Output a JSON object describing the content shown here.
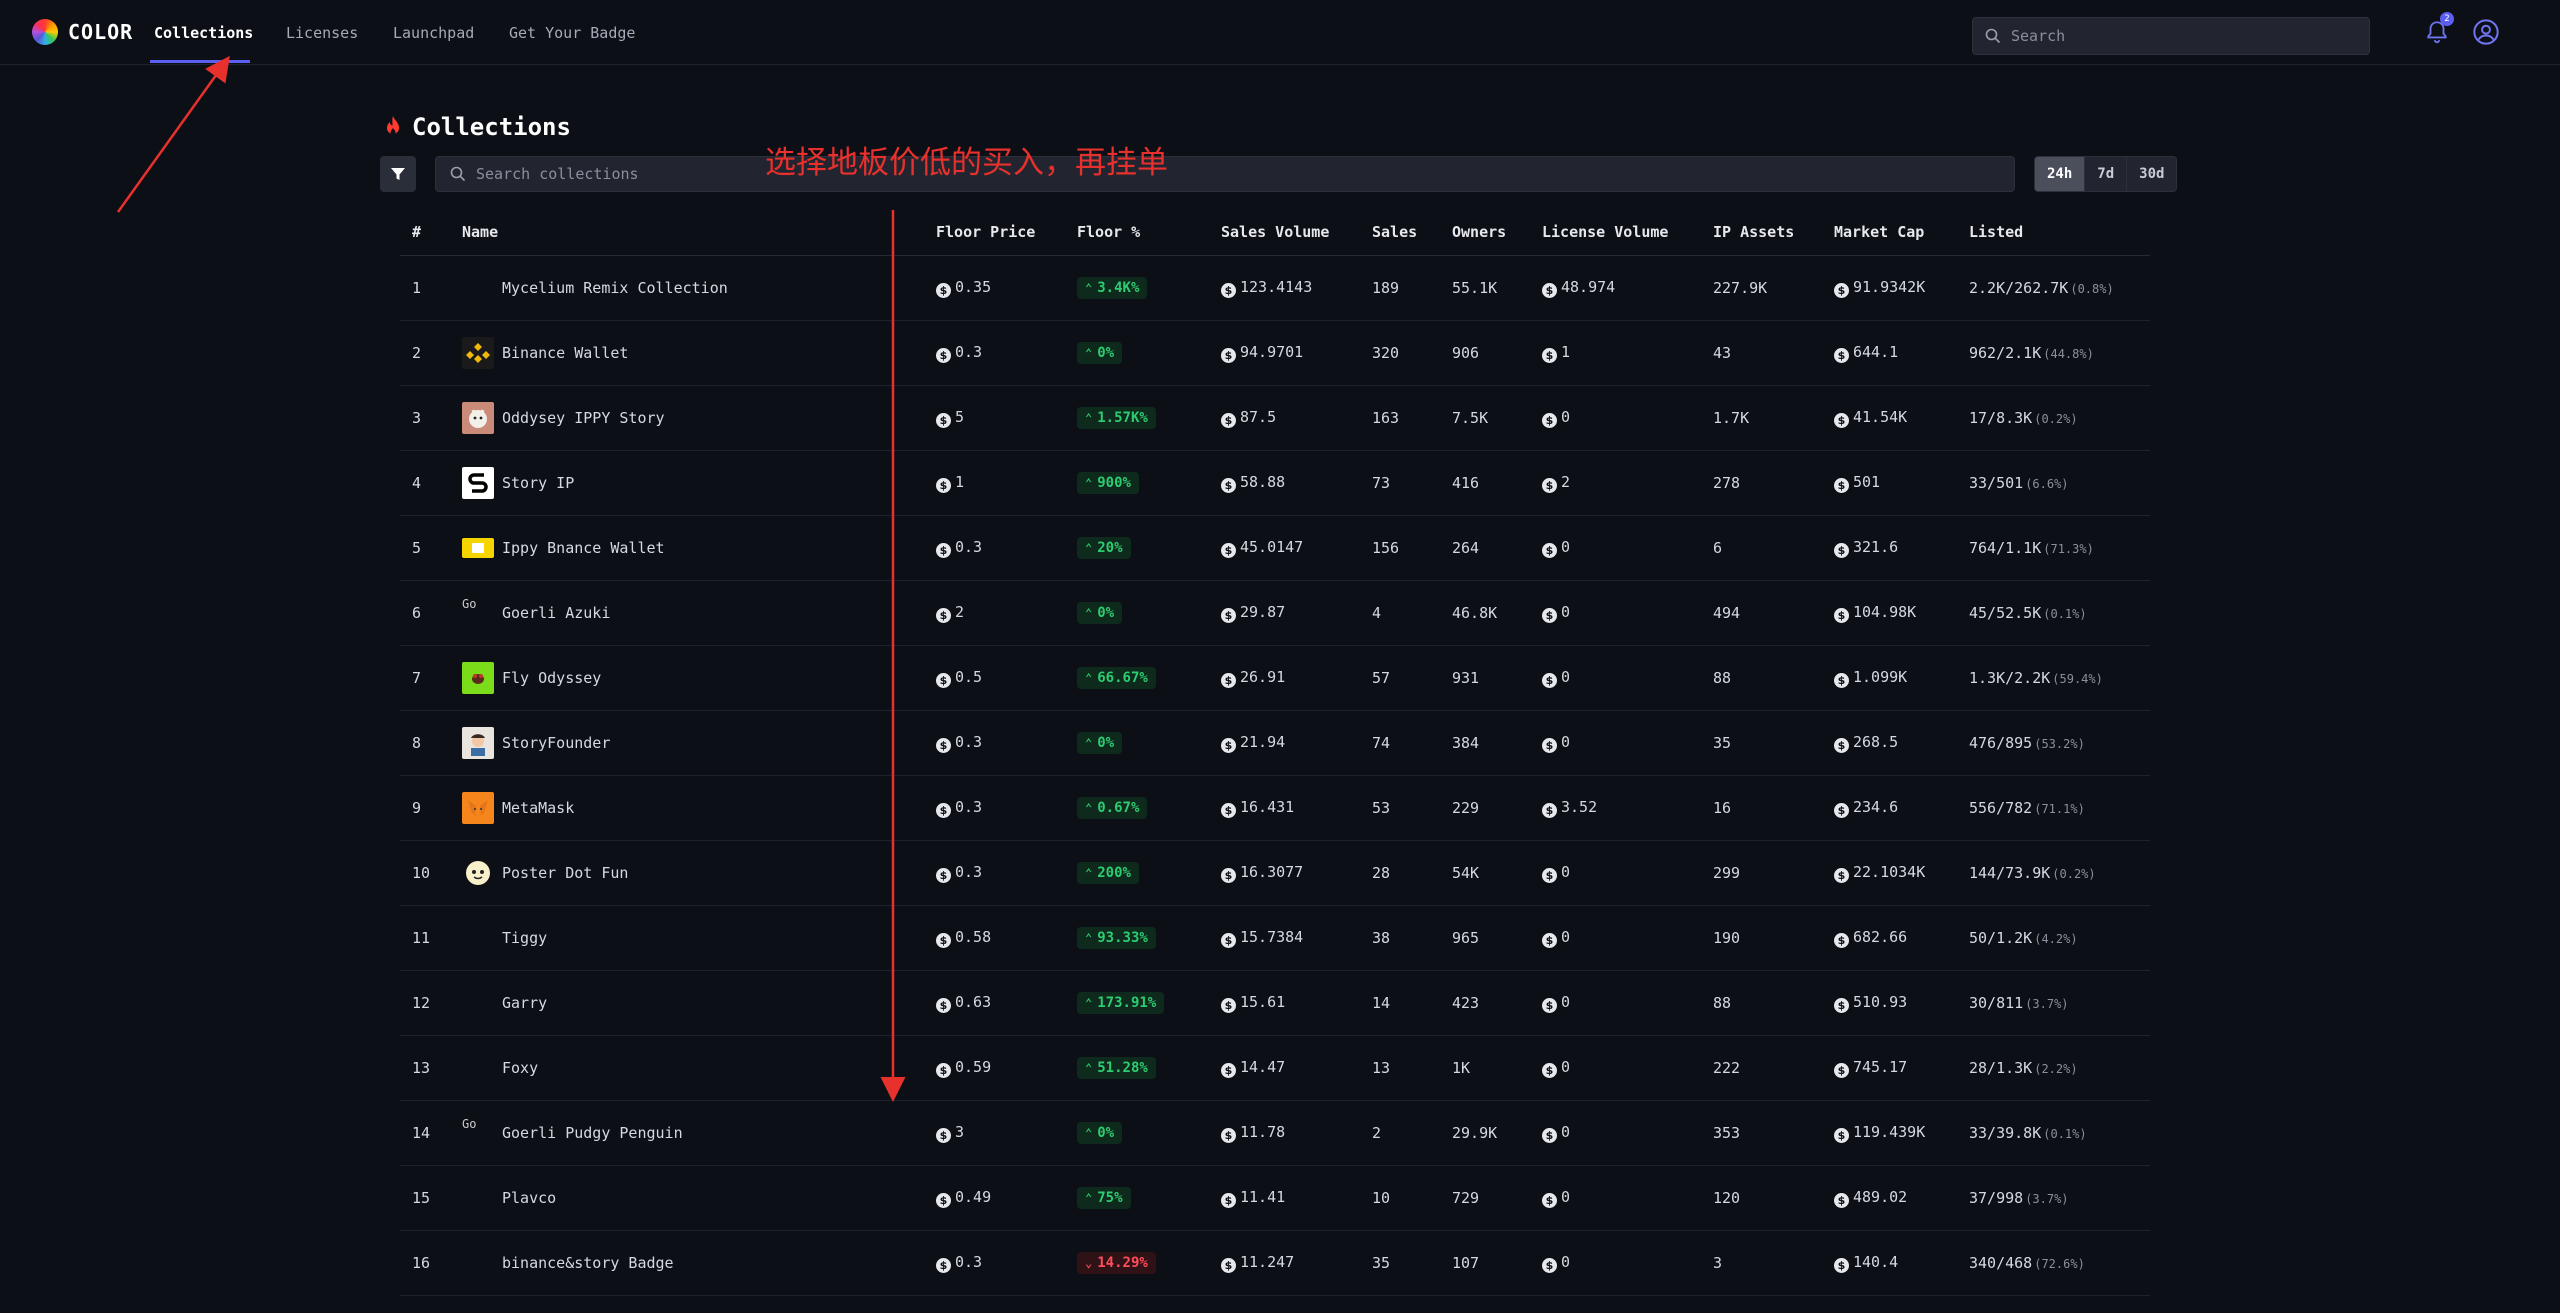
{
  "nav": {
    "logo_text": "COLOR",
    "links": [
      "Collections",
      "Licenses",
      "Launchpad",
      "Get Your Badge"
    ],
    "search_placeholder": "Search",
    "notification_count": "2"
  },
  "page": {
    "title": "Collections",
    "search_placeholder": "Search collections",
    "ranges": [
      "24h",
      "7d",
      "30d"
    ],
    "active_range": "24h"
  },
  "annotation": {
    "text": "选择地板价低的买入，再挂单",
    "color": "#e8302c"
  },
  "colors": {
    "accent": "#5b5ff0",
    "positive": "#2ecc71",
    "negative": "#ff4d5a",
    "background": "#0d0f16"
  },
  "table": {
    "headers": [
      "#",
      "Name",
      "Floor Price",
      "Floor %",
      "Sales Volume",
      "Sales",
      "Owners",
      "License Volume",
      "IP Assets",
      "Market Cap",
      "Listed"
    ],
    "rows": [
      {
        "rank": "1",
        "name": "Mycelium Remix Collection",
        "thumb": "none",
        "floor": "0.35",
        "pct": "3.4K%",
        "dir": "up",
        "volume": "123.4143",
        "sales": "189",
        "owners": "55.1K",
        "license": "48.974",
        "ip": "227.9K",
        "mcap": "91.9342K",
        "listed": "2.2K/262.7K",
        "listed_pct": "(0.8%)"
      },
      {
        "rank": "2",
        "name": "Binance Wallet",
        "thumb": "binance",
        "floor": "0.3",
        "pct": "0%",
        "dir": "up",
        "volume": "94.9701",
        "sales": "320",
        "owners": "906",
        "license": "1",
        "ip": "43",
        "mcap": "644.1",
        "listed": "962/2.1K",
        "listed_pct": "(44.8%)"
      },
      {
        "rank": "3",
        "name": "Oddysey IPPY Story",
        "thumb": "ippy",
        "floor": "5",
        "pct": "1.57K%",
        "dir": "up",
        "volume": "87.5",
        "sales": "163",
        "owners": "7.5K",
        "license": "0",
        "ip": "1.7K",
        "mcap": "41.54K",
        "listed": "17/8.3K",
        "listed_pct": "(0.2%)"
      },
      {
        "rank": "4",
        "name": "Story IP",
        "thumb": "story",
        "floor": "1",
        "pct": "900%",
        "dir": "up",
        "volume": "58.88",
        "sales": "73",
        "owners": "416",
        "license": "2",
        "ip": "278",
        "mcap": "501",
        "listed": "33/501",
        "listed_pct": "(6.6%)"
      },
      {
        "rank": "5",
        "name": "Ippy Bnance Wallet",
        "thumb": "yellow",
        "floor": "0.3",
        "pct": "20%",
        "dir": "up",
        "volume": "45.0147",
        "sales": "156",
        "owners": "264",
        "license": "0",
        "ip": "6",
        "mcap": "321.6",
        "listed": "764/1.1K",
        "listed_pct": "(71.3%)"
      },
      {
        "rank": "6",
        "name": "Goerli Azuki",
        "thumb": "broken",
        "thumb_alt": "Go",
        "floor": "2",
        "pct": "0%",
        "dir": "up",
        "volume": "29.87",
        "sales": "4",
        "owners": "46.8K",
        "license": "0",
        "ip": "494",
        "mcap": "104.98K",
        "listed": "45/52.5K",
        "listed_pct": "(0.1%)"
      },
      {
        "rank": "7",
        "name": "Fly Odyssey",
        "thumb": "fly",
        "floor": "0.5",
        "pct": "66.67%",
        "dir": "up",
        "volume": "26.91",
        "sales": "57",
        "owners": "931",
        "license": "0",
        "ip": "88",
        "mcap": "1.099K",
        "listed": "1.3K/2.2K",
        "listed_pct": "(59.4%)"
      },
      {
        "rank": "8",
        "name": "StoryFounder",
        "thumb": "founder",
        "floor": "0.3",
        "pct": "0%",
        "dir": "up",
        "volume": "21.94",
        "sales": "74",
        "owners": "384",
        "license": "0",
        "ip": "35",
        "mcap": "268.5",
        "listed": "476/895",
        "listed_pct": "(53.2%)"
      },
      {
        "rank": "9",
        "name": "MetaMask",
        "thumb": "metamask",
        "floor": "0.3",
        "pct": "0.67%",
        "dir": "up",
        "volume": "16.431",
        "sales": "53",
        "owners": "229",
        "license": "3.52",
        "ip": "16",
        "mcap": "234.6",
        "listed": "556/782",
        "listed_pct": "(71.1%)"
      },
      {
        "rank": "10",
        "name": "Poster Dot Fun",
        "thumb": "poster",
        "floor": "0.3",
        "pct": "200%",
        "dir": "up",
        "volume": "16.3077",
        "sales": "28",
        "owners": "54K",
        "license": "0",
        "ip": "299",
        "mcap": "22.1034K",
        "listed": "144/73.9K",
        "listed_pct": "(0.2%)"
      },
      {
        "rank": "11",
        "name": "Tiggy",
        "thumb": "none",
        "floor": "0.58",
        "pct": "93.33%",
        "dir": "up",
        "volume": "15.7384",
        "sales": "38",
        "owners": "965",
        "license": "0",
        "ip": "190",
        "mcap": "682.66",
        "listed": "50/1.2K",
        "listed_pct": "(4.2%)"
      },
      {
        "rank": "12",
        "name": "Garry",
        "thumb": "none",
        "floor": "0.63",
        "pct": "173.91%",
        "dir": "up",
        "volume": "15.61",
        "sales": "14",
        "owners": "423",
        "license": "0",
        "ip": "88",
        "mcap": "510.93",
        "listed": "30/811",
        "listed_pct": "(3.7%)"
      },
      {
        "rank": "13",
        "name": "Foxy",
        "thumb": "none",
        "floor": "0.59",
        "pct": "51.28%",
        "dir": "up",
        "volume": "14.47",
        "sales": "13",
        "owners": "1K",
        "license": "0",
        "ip": "222",
        "mcap": "745.17",
        "listed": "28/1.3K",
        "listed_pct": "(2.2%)"
      },
      {
        "rank": "14",
        "name": "Goerli Pudgy Penguin",
        "thumb": "broken",
        "thumb_alt": "Go",
        "floor": "3",
        "pct": "0%",
        "dir": "up",
        "volume": "11.78",
        "sales": "2",
        "owners": "29.9K",
        "license": "0",
        "ip": "353",
        "mcap": "119.439K",
        "listed": "33/39.8K",
        "listed_pct": "(0.1%)"
      },
      {
        "rank": "15",
        "name": "Plavco",
        "thumb": "none",
        "floor": "0.49",
        "pct": "75%",
        "dir": "up",
        "volume": "11.41",
        "sales": "10",
        "owners": "729",
        "license": "0",
        "ip": "120",
        "mcap": "489.02",
        "listed": "37/998",
        "listed_pct": "(3.7%)"
      },
      {
        "rank": "16",
        "name": "binance&story Badge",
        "thumb": "none",
        "floor": "0.3",
        "pct": "14.29%",
        "dir": "down",
        "volume": "11.247",
        "sales": "35",
        "owners": "107",
        "license": "0",
        "ip": "3",
        "mcap": "140.4",
        "listed": "340/468",
        "listed_pct": "(72.6%)"
      }
    ]
  }
}
